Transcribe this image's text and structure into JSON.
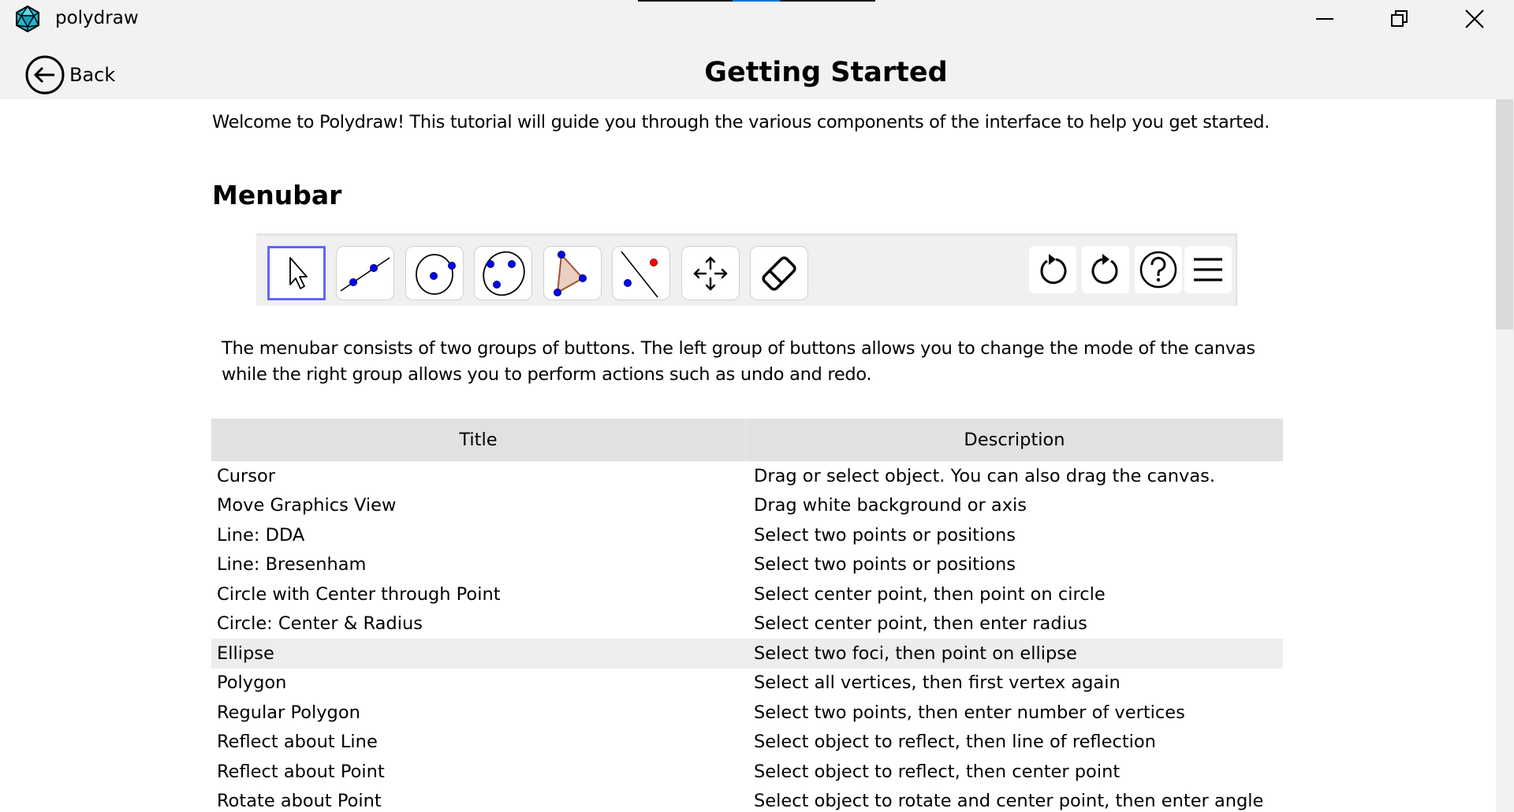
{
  "window": {
    "app_title": "polydraw",
    "icons": {
      "app": "icosahedron-logo-icon",
      "minimize": "minimize-icon",
      "maximize": "restore-icon",
      "close": "close-icon"
    }
  },
  "header": {
    "back_label": "Back",
    "back_icon": "arrow-left-circle-icon",
    "page_title": "Getting Started"
  },
  "content": {
    "intro": "Welcome to Polydraw! This tutorial will guide you through the various components of the interface to help you get started.",
    "section_title": "Menubar",
    "menubar_image": {
      "mode_tools": [
        {
          "name": "cursor",
          "icon": "cursor-arrow-icon",
          "active": true
        },
        {
          "name": "line",
          "icon": "line-through-points-icon",
          "active": false
        },
        {
          "name": "circle-center-point",
          "icon": "circle-center-point-icon",
          "active": false
        },
        {
          "name": "ellipse",
          "icon": "ellipse-icon",
          "active": false
        },
        {
          "name": "polygon",
          "icon": "polygon-icon",
          "active": false
        },
        {
          "name": "reflect",
          "icon": "reflect-about-line-icon",
          "active": false
        },
        {
          "name": "move-graphics-view",
          "icon": "move-arrows-icon",
          "active": false
        },
        {
          "name": "eraser",
          "icon": "eraser-icon",
          "active": false
        }
      ],
      "actions": [
        {
          "name": "undo",
          "icon": "undo-icon"
        },
        {
          "name": "redo",
          "icon": "redo-icon"
        },
        {
          "name": "help",
          "icon": "help-circle-icon"
        },
        {
          "name": "menu",
          "icon": "hamburger-menu-icon"
        }
      ],
      "colors": {
        "active_border": "#6464ff",
        "point": "#0000ff",
        "red_point": "#ff0000",
        "polygon_fill": "#e8cfc2",
        "polygon_stroke": "#a0522d"
      }
    },
    "menubar_description": "The menubar consists of two groups of buttons. The left group of buttons allows you to change the mode of the canvas while the right group allows you to perform actions such as undo and redo.",
    "table": {
      "headers": [
        "Title",
        "Description"
      ],
      "rows": [
        {
          "title": "Cursor",
          "description": "Drag or select object. You can also drag the canvas."
        },
        {
          "title": "Move Graphics View",
          "description": "Drag white background or axis"
        },
        {
          "title": "Line: DDA",
          "description": "Select two points or positions"
        },
        {
          "title": "Line: Bresenham",
          "description": "Select two points or positions"
        },
        {
          "title": "Circle with Center through Point",
          "description": "Select center point, then point on circle"
        },
        {
          "title": "Circle: Center & Radius",
          "description": "Select center point, then enter radius"
        },
        {
          "title": "Ellipse",
          "description": "Select two foci, then point on ellipse",
          "highlighted": true
        },
        {
          "title": "Polygon",
          "description": "Select all vertices, then first vertex again"
        },
        {
          "title": "Regular Polygon",
          "description": "Select two points, then enter number of vertices"
        },
        {
          "title": "Reflect about Line",
          "description": "Select object to reflect, then line of reflection"
        },
        {
          "title": "Reflect about Point",
          "description": "Select object to reflect, then center point"
        },
        {
          "title": "Rotate about Point",
          "description": "Select object to rotate and center point, then enter angle"
        }
      ]
    }
  }
}
